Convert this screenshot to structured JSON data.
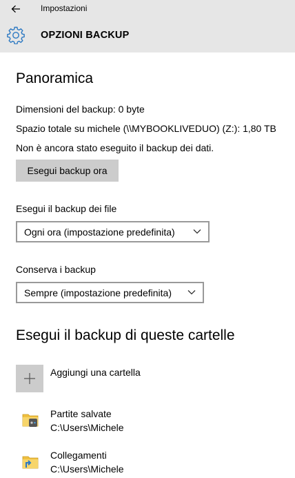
{
  "header": {
    "app_title": "Impostazioni",
    "page_heading": "OPZIONI BACKUP",
    "back_icon": "back-arrow-icon",
    "settings_icon": "gear-icon"
  },
  "overview": {
    "title": "Panoramica",
    "backup_size": "Dimensioni del backup: 0 byte",
    "total_space": "Spazio totale su michele (\\\\MYBOOKLIVEDUO) (Z:): 1,80 TB",
    "status": "Non è ancora stato eseguito il backup dei dati.",
    "backup_now_label": "Esegui backup ora"
  },
  "frequency": {
    "label": "Esegui il backup dei file",
    "selected": "Ogni ora (impostazione predefinita)"
  },
  "retention": {
    "label": "Conserva i backup",
    "selected": "Sempre (impostazione predefinita)"
  },
  "folders": {
    "title": "Esegui il backup di queste cartelle",
    "add_label": "Aggiungi una cartella",
    "items": [
      {
        "name": "Partite salvate",
        "path": "C:\\Users\\Michele",
        "icon": "saved-games-folder-icon"
      },
      {
        "name": "Collegamenti",
        "path": "C:\\Users\\Michele",
        "icon": "links-folder-icon"
      }
    ]
  },
  "colors": {
    "header_bg": "#e6e6e6",
    "accent": "#2b78c2",
    "button_bg": "#cccccc",
    "combo_border": "#999999"
  }
}
